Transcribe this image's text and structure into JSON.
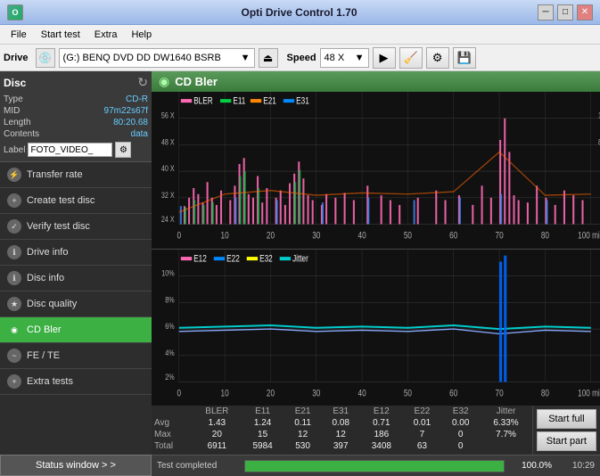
{
  "titleBar": {
    "title": "Opti Drive Control 1.70"
  },
  "menuBar": {
    "items": [
      "File",
      "Start test",
      "Extra",
      "Help"
    ]
  },
  "driveBar": {
    "driveLabel": "Drive",
    "driveValue": "(G:)  BENQ DVD DD DW1640 BSRB",
    "speedLabel": "Speed",
    "speedValue": "48 X"
  },
  "disc": {
    "title": "Disc",
    "type_label": "Type",
    "type_value": "CD-R",
    "mid_label": "MID",
    "mid_value": "97m22s67f",
    "length_label": "Length",
    "length_value": "80:20.68",
    "contents_label": "Contents",
    "contents_value": "data",
    "label_label": "Label",
    "label_value": "FOTO_VIDEO_"
  },
  "nav": {
    "items": [
      {
        "id": "transfer-rate",
        "label": "Transfer rate",
        "active": false
      },
      {
        "id": "create-test-disc",
        "label": "Create test disc",
        "active": false
      },
      {
        "id": "verify-test-disc",
        "label": "Verify test disc",
        "active": false
      },
      {
        "id": "drive-info",
        "label": "Drive info",
        "active": false
      },
      {
        "id": "disc-info",
        "label": "Disc info",
        "active": false
      },
      {
        "id": "disc-quality",
        "label": "Disc quality",
        "active": false
      },
      {
        "id": "cd-bler",
        "label": "CD Bler",
        "active": true
      },
      {
        "id": "fe-te",
        "label": "FE / TE",
        "active": false
      },
      {
        "id": "extra-tests",
        "label": "Extra tests",
        "active": false
      }
    ],
    "statusWindow": "Status window > >"
  },
  "chart": {
    "title": "CD Bler",
    "topLegend": [
      "BLER",
      "E11",
      "E21",
      "E31"
    ],
    "topLegendColors": [
      "#ff69b4",
      "#00ff00",
      "#ff6600",
      "#0099ff"
    ],
    "bottomLegend": [
      "E12",
      "E22",
      "E32",
      "Jitter"
    ],
    "bottomLegendColors": [
      "#ff69b4",
      "#00aaff",
      "#ffff00",
      "#00ffff"
    ]
  },
  "stats": {
    "headers": [
      "BLER",
      "E11",
      "E21",
      "E31",
      "E12",
      "E22",
      "E32",
      "Jitter"
    ],
    "avg": [
      "1.43",
      "1.24",
      "0.11",
      "0.08",
      "0.71",
      "0.01",
      "0.00",
      "6.33%"
    ],
    "max": [
      "20",
      "15",
      "12",
      "12",
      "186",
      "7",
      "0",
      "7.7%"
    ],
    "total": [
      "6911",
      "5984",
      "530",
      "397",
      "3408",
      "63",
      "0",
      ""
    ],
    "rowLabels": [
      "Avg",
      "Max",
      "Total"
    ]
  },
  "buttons": {
    "startFull": "Start full",
    "startPart": "Start part"
  },
  "progressBar": {
    "label": "Test completed",
    "percent": "100.0%",
    "time": "10:29",
    "fillPercent": 100
  }
}
